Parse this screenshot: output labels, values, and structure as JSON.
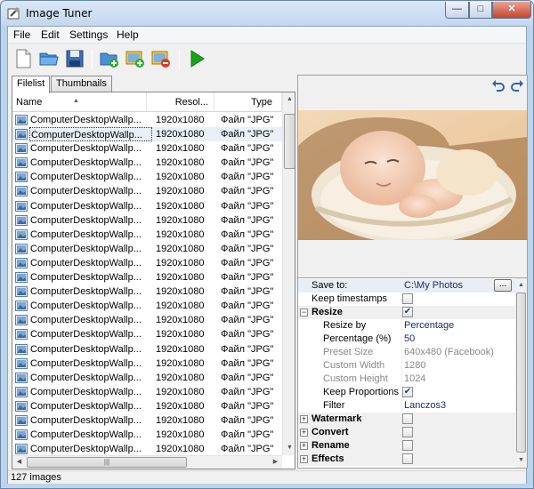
{
  "window": {
    "title": "Image Tuner"
  },
  "menu": [
    "File",
    "Edit",
    "Settings",
    "Help"
  ],
  "toolbar": {
    "buttons": [
      "new-file",
      "open-folder",
      "save",
      "add-folder",
      "add-images",
      "remove-images",
      "run"
    ]
  },
  "tabs": [
    "Filelist",
    "Thumbnails"
  ],
  "filelist": {
    "columns": [
      "Name",
      "Resol...",
      "Type"
    ],
    "rows": [
      {
        "name": "ComputerDesktopWallp...",
        "res": "1920x1080",
        "type": "Файл \"JPG\""
      },
      {
        "name": "ComputerDesktopWallp...",
        "res": "1920x1080",
        "type": "Файл \"JPG\""
      },
      {
        "name": "ComputerDesktopWallp...",
        "res": "1920x1080",
        "type": "Файл \"JPG\""
      },
      {
        "name": "ComputerDesktopWallp...",
        "res": "1920x1080",
        "type": "Файл \"JPG\""
      },
      {
        "name": "ComputerDesktopWallp...",
        "res": "1920x1080",
        "type": "Файл \"JPG\""
      },
      {
        "name": "ComputerDesktopWallp...",
        "res": "1920x1080",
        "type": "Файл \"JPG\""
      },
      {
        "name": "ComputerDesktopWallp...",
        "res": "1920x1080",
        "type": "Файл \"JPG\""
      },
      {
        "name": "ComputerDesktopWallp...",
        "res": "1920x1080",
        "type": "Файл \"JPG\""
      },
      {
        "name": "ComputerDesktopWallp...",
        "res": "1920x1080",
        "type": "Файл \"JPG\""
      },
      {
        "name": "ComputerDesktopWallp...",
        "res": "1920x1080",
        "type": "Файл \"JPG\""
      },
      {
        "name": "ComputerDesktopWallp...",
        "res": "1920x1080",
        "type": "Файл \"JPG\""
      },
      {
        "name": "ComputerDesktopWallp...",
        "res": "1920x1080",
        "type": "Файл \"JPG\""
      },
      {
        "name": "ComputerDesktopWallp...",
        "res": "1920x1080",
        "type": "Файл \"JPG\""
      },
      {
        "name": "ComputerDesktopWallp...",
        "res": "1920x1080",
        "type": "Файл \"JPG\""
      },
      {
        "name": "ComputerDesktopWallp...",
        "res": "1920x1080",
        "type": "Файл \"JPG\""
      },
      {
        "name": "ComputerDesktopWallp...",
        "res": "1920x1080",
        "type": "Файл \"JPG\""
      },
      {
        "name": "ComputerDesktopWallp...",
        "res": "1920x1080",
        "type": "Файл \"JPG\""
      },
      {
        "name": "ComputerDesktopWallp...",
        "res": "1920x1080",
        "type": "Файл \"JPG\""
      },
      {
        "name": "ComputerDesktopWallp...",
        "res": "1920x1080",
        "type": "Файл \"JPG\""
      },
      {
        "name": "ComputerDesktopWallp...",
        "res": "1920x1080",
        "type": "Файл \"JPG\""
      },
      {
        "name": "ComputerDesktopWallp...",
        "res": "1920x1080",
        "type": "Файл \"JPG\""
      },
      {
        "name": "ComputerDesktopWallp...",
        "res": "1920x1080",
        "type": "Файл \"JPG\""
      },
      {
        "name": "ComputerDesktopWallp...",
        "res": "1920x1080",
        "type": "Файл \"JPG\""
      },
      {
        "name": "ComputerDesktopWallp...",
        "res": "1920x1080",
        "type": "Файл \"JPG\""
      },
      {
        "name": "ComputerDesktopWallp...",
        "res": "1920x1080",
        "type": "Файл \"JPG\""
      }
    ],
    "selected_index": 1
  },
  "status": {
    "text": "127 images"
  },
  "properties": {
    "save_to_label": "Save to:",
    "save_to_value": "C:\\My Photos",
    "browse_label": "...",
    "keep_timestamps_label": "Keep timestamps",
    "resize_label": "Resize",
    "resize_by_label": "Resize by",
    "resize_by_value": "Percentage",
    "percentage_label": "Percentage (%)",
    "percentage_value": "50",
    "preset_size_label": "Preset Size",
    "preset_size_value": "640x480 (Facebook)",
    "custom_width_label": "Custom Width",
    "custom_width_value": "1280",
    "custom_height_label": "Custom Height",
    "custom_height_value": "1024",
    "keep_proportions_label": "Keep Proportions",
    "filter_label": "Filter",
    "filter_value": "Lanczos3",
    "watermark_label": "Watermark",
    "convert_label": "Convert",
    "rename_label": "Rename",
    "effects_label": "Effects",
    "keep_timestamps_checked": false,
    "resize_checked": true,
    "keep_proportions_checked": true,
    "watermark_checked": false,
    "convert_checked": false,
    "rename_checked": false,
    "effects_checked": false
  },
  "colors": {
    "accent": "#1f3a7d",
    "run_button": "#1aa31a",
    "selection": "#e9f0f8"
  }
}
